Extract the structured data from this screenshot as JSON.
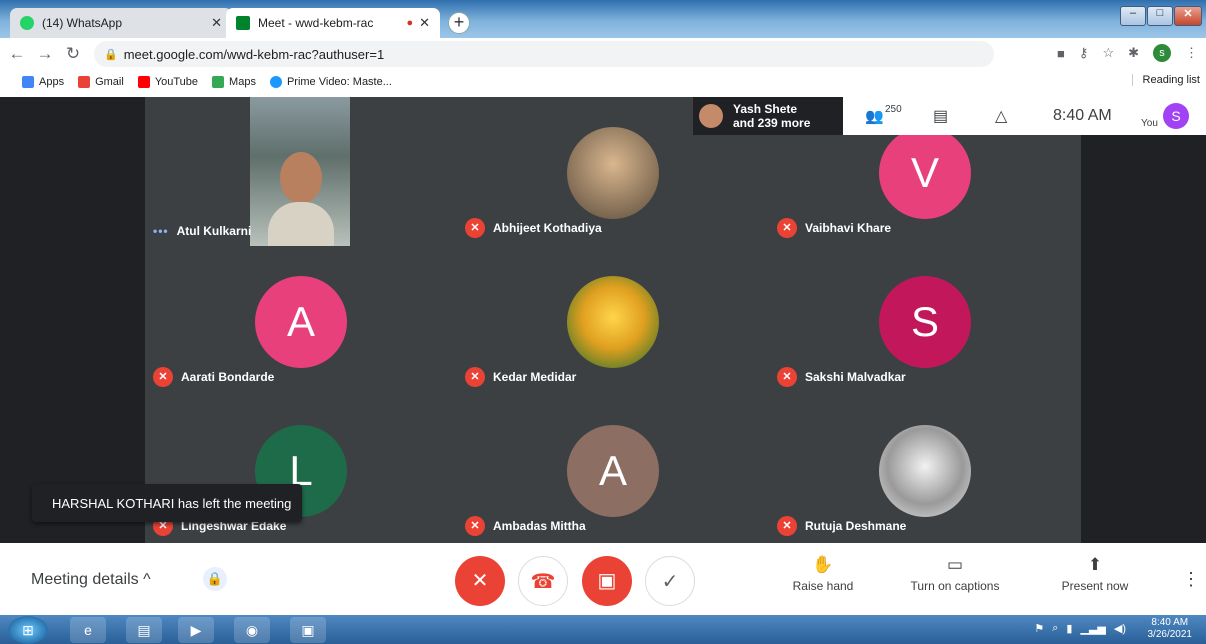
{
  "browser": {
    "tabs": [
      {
        "label": "(14) WhatsApp",
        "badge": "14"
      },
      {
        "label": "Meet - wwd-kebm-rac"
      }
    ],
    "url": "meet.google.com/wwd-kebm-rac?authuser=1",
    "profile_initial": "s",
    "bookmarks": [
      "Apps",
      "Gmail",
      "YouTube",
      "Maps",
      "Prime Video: Maste..."
    ],
    "reading_list": "Reading list"
  },
  "meet": {
    "participants": [
      {
        "name": "Atul Kulkarni",
        "type": "video"
      },
      {
        "name": "Abhijeet Kothadiya",
        "type": "photo"
      },
      {
        "name": "Vaibhavi Khare",
        "initial": "V",
        "color": "#e8407a"
      },
      {
        "name": "Aarati Bondarde",
        "initial": "A",
        "color": "#e8407a"
      },
      {
        "name": "Kedar Medidar",
        "type": "photo"
      },
      {
        "name": "Sakshi Malvadkar",
        "initial": "S",
        "color": "#c2185b"
      },
      {
        "name": "Lingeshwar Edake",
        "initial": "L",
        "color": "#1e6b4a"
      },
      {
        "name": "Ambadas Mittha",
        "initial": "A",
        "color": "#8d6e63"
      },
      {
        "name": "Rutuja Deshmane",
        "type": "photo"
      }
    ],
    "presenter": {
      "line1": "Yash Shete",
      "line2": "and 239 more"
    },
    "people_count": "250",
    "time": "8:40 AM",
    "you_label": "You",
    "you_initial": "S",
    "toast": "HARSHAL KOTHARI has left the meeting",
    "meeting_details": "Meeting details",
    "actions": {
      "raise_hand": "Raise hand",
      "captions": "Turn on captions",
      "present": "Present now"
    }
  },
  "taskbar": {
    "time": "8:40 AM",
    "date": "3/26/2021"
  },
  "colors": {
    "accent_red": "#ea4335",
    "meet_bg": "#202124",
    "tile_bg": "#3c4043"
  }
}
